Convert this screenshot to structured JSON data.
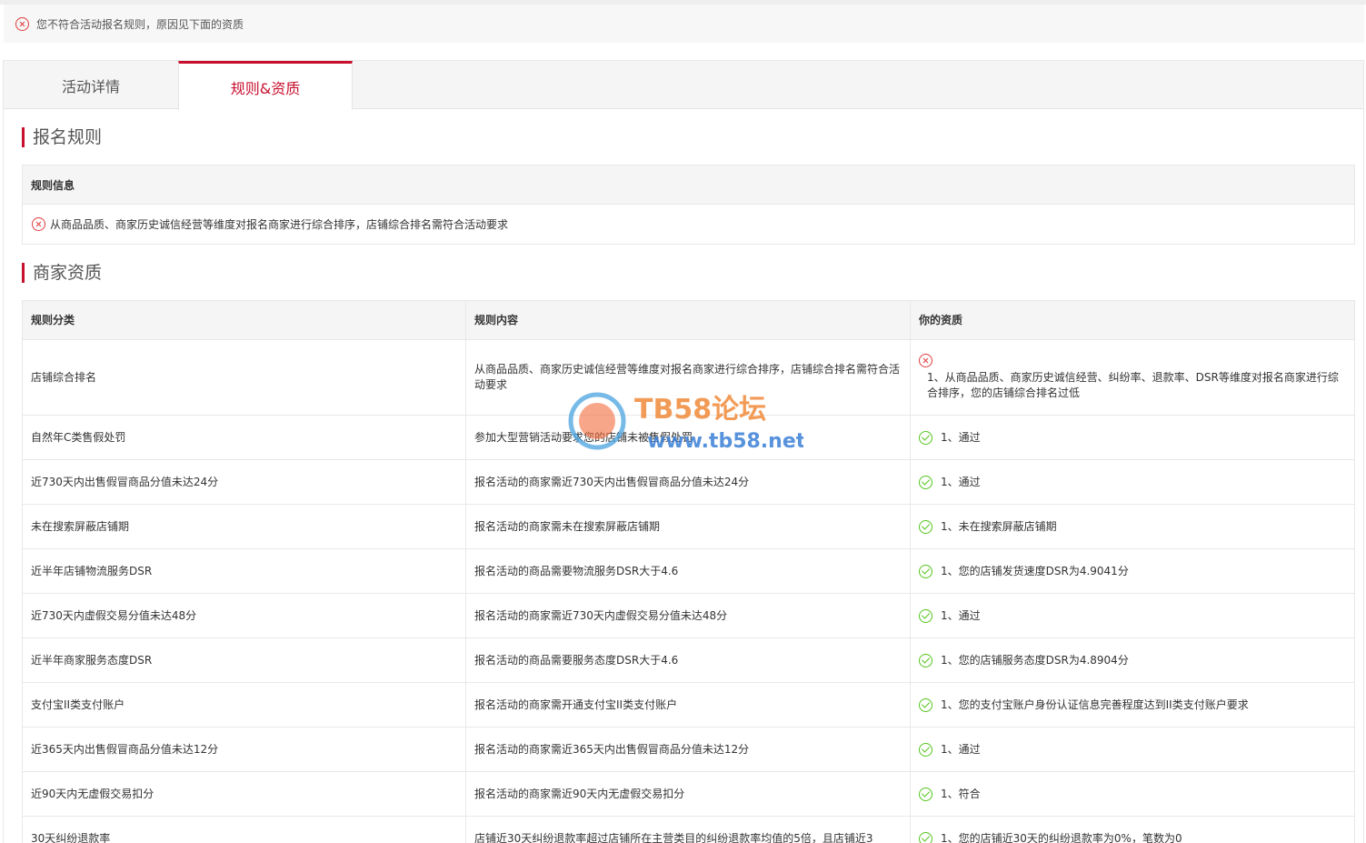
{
  "alert": {
    "text": "您不符合活动报名规则，原因见下面的资质"
  },
  "tabs": [
    {
      "label": "活动详情"
    },
    {
      "label": "规则&资质"
    }
  ],
  "rules_section": {
    "title": "报名规则",
    "box_header": "规则信息",
    "item_text": "从商品品质、商家历史诚信经营等维度对报名商家进行综合排序，店铺综合排名需符合活动要求"
  },
  "qual_section": {
    "title": "商家资质",
    "headers": [
      "规则分类",
      "规则内容",
      "你的资质"
    ],
    "rows": [
      {
        "category": "店铺综合排名",
        "content": "从商品品质、商家历史诚信经营等维度对报名商家进行综合排序，店铺综合排名需符合活动要求",
        "status": "fail",
        "qual": "1、从商品品质、商家历史诚信经营、纠纷率、退款率、DSR等维度对报名商家进行综合排序，您的店铺综合排名过低"
      },
      {
        "category": "自然年C类售假处罚",
        "content": "参加大型营销活动要求您的店铺未被售假处罚",
        "status": "pass",
        "qual": "1、通过"
      },
      {
        "category": "近730天内出售假冒商品分值未达24分",
        "content": "报名活动的商家需近730天内出售假冒商品分值未达24分",
        "status": "pass",
        "qual": "1、通过"
      },
      {
        "category": "未在搜索屏蔽店铺期",
        "content": "报名活动的商家需未在搜索屏蔽店铺期",
        "status": "pass",
        "qual": "1、未在搜索屏蔽店铺期"
      },
      {
        "category": "近半年店铺物流服务DSR",
        "content": "报名活动的商品需要物流服务DSR大于4.6",
        "status": "pass",
        "qual": "1、您的店铺发货速度DSR为4.9041分"
      },
      {
        "category": "近730天内虚假交易分值未达48分",
        "content": "报名活动的商家需近730天内虚假交易分值未达48分",
        "status": "pass",
        "qual": "1、通过"
      },
      {
        "category": "近半年商家服务态度DSR",
        "content": "报名活动的商品需要服务态度DSR大于4.6",
        "status": "pass",
        "qual": "1、您的店铺服务态度DSR为4.8904分"
      },
      {
        "category": "支付宝II类支付账户",
        "content": "报名活动的商家需开通支付宝II类支付账户",
        "status": "pass",
        "qual": "1、您的支付宝账户身份认证信息完善程度达到II类支付账户要求"
      },
      {
        "category": "近365天内出售假冒商品分值未达12分",
        "content": "报名活动的商家需近365天内出售假冒商品分值未达12分",
        "status": "pass",
        "qual": "1、通过"
      },
      {
        "category": "近90天内无虚假交易扣分",
        "content": "报名活动的商家需近90天内无虚假交易扣分",
        "status": "pass",
        "qual": "1、符合"
      },
      {
        "category": "30天纠纷退款率",
        "content": "店铺近30天纠纷退款率超过店铺所在主营类目的纠纷退款率均值的5倍，且店铺近3",
        "status": "pass",
        "qual": "1、您的店铺近30天的纠纷退款率为0%，笔数为0"
      }
    ]
  },
  "watermark": {
    "title": "TB58论坛",
    "url": "www.tb58.net"
  },
  "colors": {
    "accent": "#c8102e",
    "ok": "#52c41a",
    "error": "#e03c3c"
  }
}
